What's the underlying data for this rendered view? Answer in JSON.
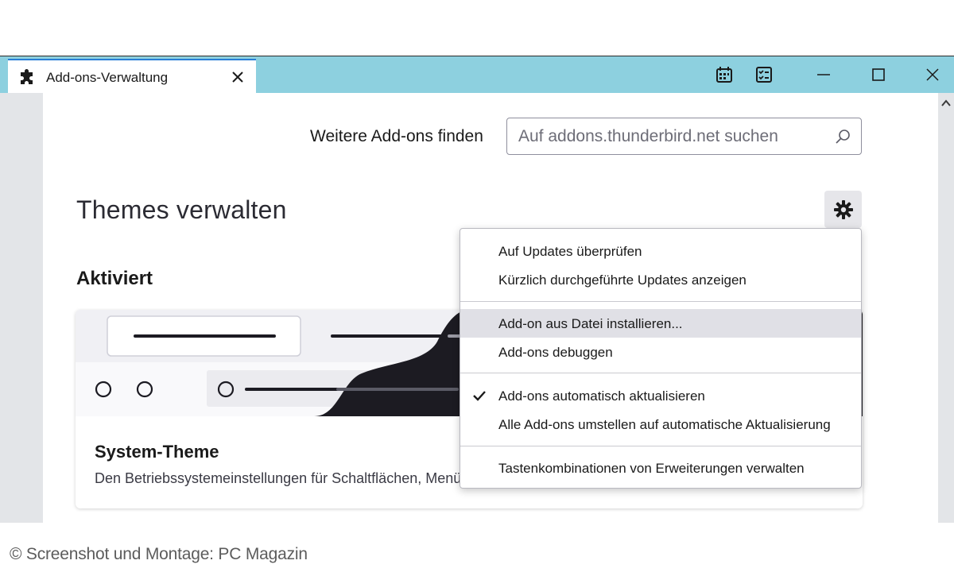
{
  "tab": {
    "label": "Add-ons-Verwaltung",
    "icon": "puzzle-icon"
  },
  "titlebar": {
    "icons": [
      "calendar-icon",
      "tasks-icon",
      "minimize-icon",
      "maximize-icon",
      "close-icon"
    ]
  },
  "search": {
    "label": "Weitere Add-ons finden",
    "placeholder": "Auf addons.thunderbird.net suchen",
    "value": ""
  },
  "page": {
    "title": "Themes verwalten"
  },
  "section": {
    "title": "Aktiviert"
  },
  "theme_card": {
    "name": "System-Theme",
    "description": "Den Betriebssystemeinstellungen für Schaltflächen, Menüs und Fenster folgen."
  },
  "menu": {
    "items": [
      {
        "label": "Auf Updates überprüfen",
        "checked": false
      },
      {
        "label": "Kürzlich durchgeführte Updates anzeigen",
        "checked": false
      },
      {
        "label": "Add-on aus Datei installieren...",
        "checked": false,
        "highlighted": true
      },
      {
        "label": "Add-ons debuggen",
        "checked": false
      },
      {
        "label": "Add-ons automatisch aktualisieren",
        "checked": true
      },
      {
        "label": "Alle Add-ons umstellen auf automatische Aktualisierung",
        "checked": false
      },
      {
        "label": "Tastenkombinationen von Erweiterungen verwalten",
        "checked": false
      }
    ]
  },
  "credit": "© Screenshot und Montage: PC Magazin",
  "colors": {
    "titlebar": "#8dd0df",
    "accent": "#2a7fd6",
    "side_strip": "#e3e5e8",
    "preview_dark": "#1c1b22"
  }
}
